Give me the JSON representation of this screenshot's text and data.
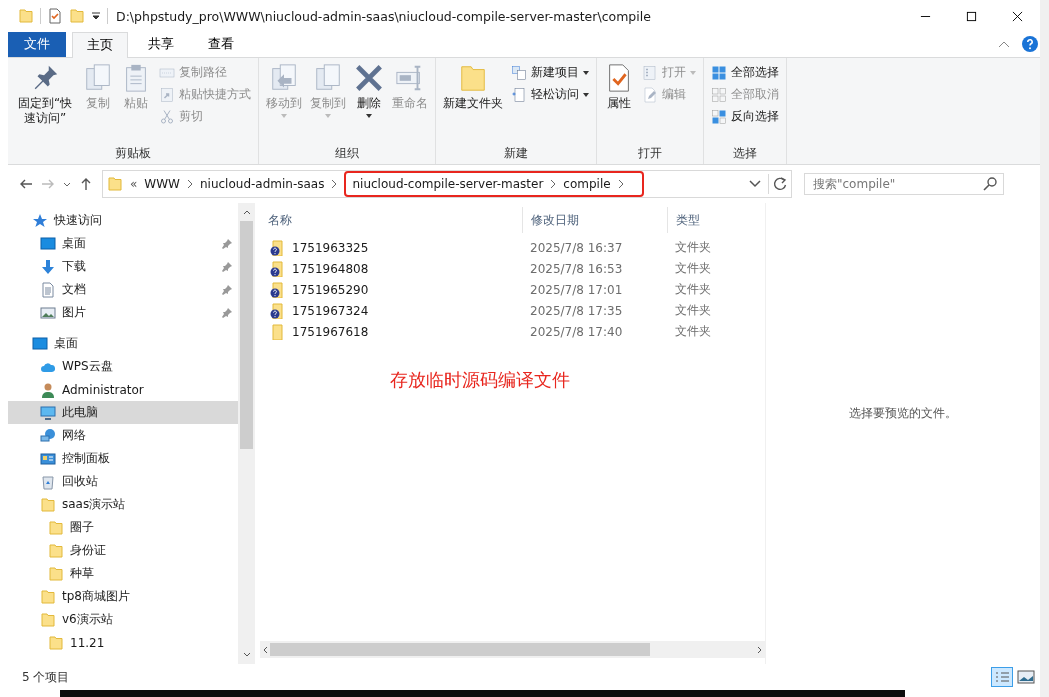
{
  "title_bar": {
    "path": "D:\\phpstudy_pro\\WWW\\niucloud-admin-saas\\niucloud-compile-server-master\\compile"
  },
  "ribbon_tabs": [
    {
      "label": "文件",
      "kind": "file",
      "selected": false
    },
    {
      "label": "主页",
      "kind": "tab",
      "selected": true
    },
    {
      "label": "共享",
      "kind": "tab",
      "selected": false
    },
    {
      "label": "查看",
      "kind": "tab",
      "selected": false
    }
  ],
  "ribbon_groups": [
    {
      "label": "剪贴板",
      "items": [
        {
          "label": "固定到“快速访问”",
          "kind": "large",
          "disabled": false,
          "has_menu": false
        },
        {
          "label": "复制",
          "kind": "large",
          "disabled": true,
          "has_menu": false
        },
        {
          "label": "粘贴",
          "kind": "large",
          "disabled": true,
          "has_menu": false
        },
        {
          "label": "复制路径",
          "kind": "small",
          "disabled": true,
          "has_menu": false
        },
        {
          "label": "粘贴快捷方式",
          "kind": "small",
          "disabled": true,
          "has_menu": false
        },
        {
          "label": "剪切",
          "kind": "small",
          "disabled": true,
          "has_menu": false
        }
      ]
    },
    {
      "label": "组织",
      "items": [
        {
          "label": "移动到",
          "kind": "large",
          "disabled": true,
          "has_menu": true
        },
        {
          "label": "复制到",
          "kind": "large",
          "disabled": true,
          "has_menu": true
        },
        {
          "label": "删除",
          "kind": "large",
          "disabled": false,
          "has_menu": true
        },
        {
          "label": "重命名",
          "kind": "large",
          "disabled": true,
          "has_menu": false
        }
      ]
    },
    {
      "label": "新建",
      "items": [
        {
          "label": "新建文件夹",
          "kind": "large",
          "disabled": false,
          "has_menu": false
        },
        {
          "label": "新建项目",
          "kind": "small",
          "disabled": false,
          "has_menu": true
        },
        {
          "label": "轻松访问",
          "kind": "small",
          "disabled": false,
          "has_menu": true
        }
      ]
    },
    {
      "label": "打开",
      "items": [
        {
          "label": "属性",
          "kind": "large",
          "disabled": false,
          "has_menu": false
        },
        {
          "label": "打开",
          "kind": "small",
          "disabled": true,
          "has_menu": true
        },
        {
          "label": "编辑",
          "kind": "small",
          "disabled": true,
          "has_menu": false
        }
      ]
    },
    {
      "label": "选择",
      "items": [
        {
          "label": "全部选择",
          "kind": "small",
          "disabled": false,
          "has_menu": false
        },
        {
          "label": "全部取消",
          "kind": "small",
          "disabled": true,
          "has_menu": false
        },
        {
          "label": "反向选择",
          "kind": "small",
          "disabled": false,
          "has_menu": false
        }
      ]
    }
  ],
  "address_bar": {
    "overflow": "«",
    "crumbs": [
      {
        "label": "WWW",
        "highlighted": false
      },
      {
        "label": "niucloud-admin-saas",
        "highlighted": false
      },
      {
        "label": "niucloud-compile-server-master",
        "highlighted": true
      },
      {
        "label": "compile",
        "highlighted": true
      }
    ]
  },
  "search": {
    "placeholder": "搜索\"compile\""
  },
  "nav_pane": {
    "items": [
      {
        "label": "快速访问",
        "kind": "star",
        "selected": false,
        "children": [
          {
            "label": "桌面",
            "kind": "desktop",
            "pinned": true,
            "selected": false
          },
          {
            "label": "下载",
            "kind": "download",
            "pinned": true,
            "selected": false
          },
          {
            "label": "文档",
            "kind": "document",
            "pinned": true,
            "selected": false
          },
          {
            "label": "图片",
            "kind": "pictures",
            "pinned": true,
            "selected": false
          }
        ]
      },
      {
        "label": "桌面",
        "kind": "desktop",
        "selected": false,
        "children": [
          {
            "label": "WPS云盘",
            "kind": "cloud",
            "selected": false
          },
          {
            "label": "Administrator",
            "kind": "user",
            "selected": false
          },
          {
            "label": "此电脑",
            "kind": "computer",
            "selected": true
          },
          {
            "label": "网络",
            "kind": "network",
            "selected": false
          },
          {
            "label": "控制面板",
            "kind": "control-panel",
            "selected": false
          },
          {
            "label": "回收站",
            "kind": "recycle",
            "selected": false
          },
          {
            "label": "saas演示站",
            "kind": "folder",
            "selected": false,
            "children": [
              {
                "label": "圈子",
                "kind": "folder",
                "selected": false
              },
              {
                "label": "身份证",
                "kind": "folder",
                "selected": false
              },
              {
                "label": "种草",
                "kind": "folder",
                "selected": false
              }
            ]
          },
          {
            "label": "tp8商城图片",
            "kind": "folder",
            "selected": false
          },
          {
            "label": "v6演示站",
            "kind": "folder",
            "selected": false,
            "children": [
              {
                "label": "11.21",
                "kind": "folder",
                "selected": false
              }
            ]
          }
        ]
      }
    ]
  },
  "file_list": {
    "columns": [
      "名称",
      "修改日期",
      "类型"
    ],
    "rows": [
      {
        "name": "1751963325",
        "modified": "2025/7/8 16:37",
        "type": "文件夹",
        "unknown_badge": true
      },
      {
        "name": "1751964808",
        "modified": "2025/7/8 16:53",
        "type": "文件夹",
        "unknown_badge": true
      },
      {
        "name": "1751965290",
        "modified": "2025/7/8 17:01",
        "type": "文件夹",
        "unknown_badge": true
      },
      {
        "name": "1751967324",
        "modified": "2025/7/8 17:35",
        "type": "文件夹",
        "unknown_badge": true
      },
      {
        "name": "1751967618",
        "modified": "2025/7/8 17:40",
        "type": "文件夹",
        "unknown_badge": false
      }
    ]
  },
  "annotation": {
    "text": "存放临时源码编译文件"
  },
  "preview_pane": {
    "message": "选择要预览的文件。"
  },
  "status_bar": {
    "item_count": "5 个项目"
  }
}
